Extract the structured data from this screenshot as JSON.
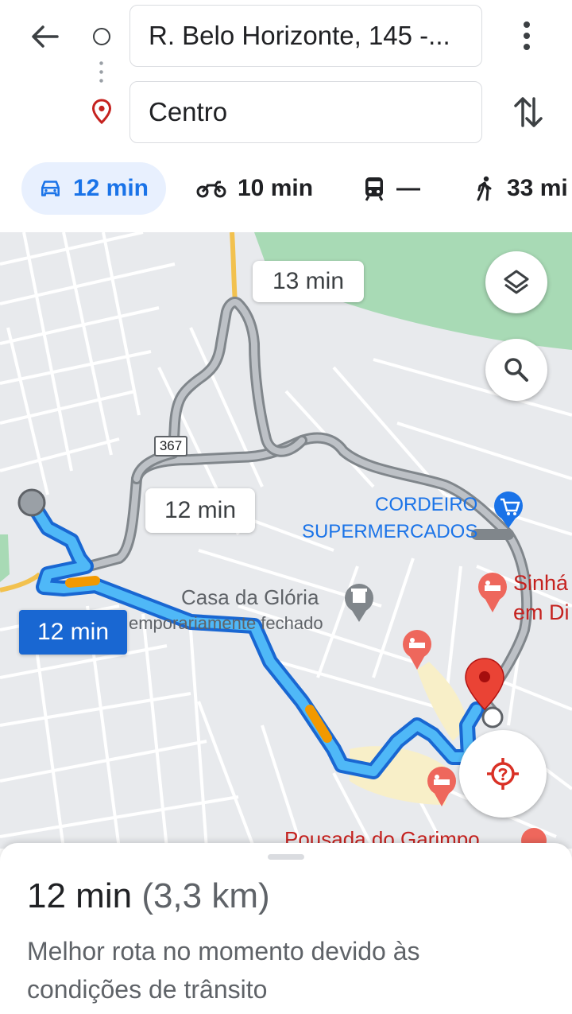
{
  "search": {
    "origin": "R. Belo Horizonte, 145 -...",
    "destination": "Centro"
  },
  "modes": [
    {
      "icon": "car-icon",
      "label": "12 min",
      "active": true
    },
    {
      "icon": "motorcycle-icon",
      "label": "10 min",
      "active": false
    },
    {
      "icon": "transit-icon",
      "label": "—",
      "active": false
    },
    {
      "icon": "walk-icon",
      "label": "33 mi",
      "active": false
    }
  ],
  "map": {
    "route_labels": {
      "alt_top": "13 min",
      "alt_middle": "12 min",
      "selected": "12 min"
    },
    "road_shield": "367",
    "places": {
      "cordeiro_line1": "CORDEIRO",
      "cordeiro_line2": "SUPERMERCADOS",
      "casa": "Casa da Glória",
      "casa_status": "emporariamente fechado",
      "sinha_line1": "Sinhá",
      "sinha_line2": "em Di",
      "pousada": "Pousada do Garimpo"
    }
  },
  "summary": {
    "time": "12 min",
    "distance": "(3,3 km)",
    "description": "Melhor rota no momento devido às condições de trânsito"
  },
  "colors": {
    "route_blue": "#1a73e8",
    "route_alt": "#9aa0a6",
    "traffic_orange": "#f29900",
    "destination_red": "#ea4335",
    "park_green": "#a8dab5"
  }
}
